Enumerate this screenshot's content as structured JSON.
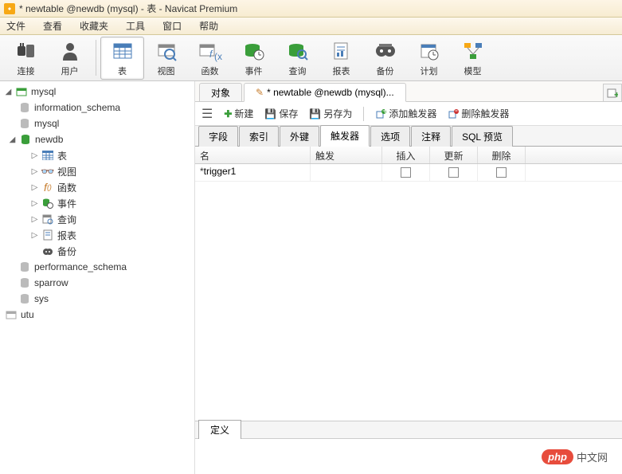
{
  "title": "* newtable @newdb (mysql) - 表 - Navicat Premium",
  "menu": [
    "文件",
    "查看",
    "收藏夹",
    "工具",
    "窗口",
    "帮助"
  ],
  "toolbar": [
    {
      "label": "连接",
      "icon": "plug"
    },
    {
      "label": "用户",
      "icon": "user"
    },
    {
      "label": "表",
      "icon": "table",
      "active": true
    },
    {
      "label": "视图",
      "icon": "view"
    },
    {
      "label": "函数",
      "icon": "fx"
    },
    {
      "label": "事件",
      "icon": "event"
    },
    {
      "label": "查询",
      "icon": "query"
    },
    {
      "label": "报表",
      "icon": "report"
    },
    {
      "label": "备份",
      "icon": "backup"
    },
    {
      "label": "计划",
      "icon": "schedule"
    },
    {
      "label": "模型",
      "icon": "model"
    }
  ],
  "tree": {
    "root": "mysql",
    "items": [
      {
        "label": "information_schema",
        "level": 2,
        "type": "db-gray"
      },
      {
        "label": "mysql",
        "level": 2,
        "type": "db-gray"
      },
      {
        "label": "newdb",
        "level": 2,
        "type": "db-green",
        "open": true
      },
      {
        "label": "表",
        "level": 3,
        "type": "table",
        "toggle": "▷"
      },
      {
        "label": "视图",
        "level": 3,
        "type": "view",
        "toggle": "▷"
      },
      {
        "label": "函数",
        "level": 3,
        "type": "fx",
        "toggle": "▷"
      },
      {
        "label": "事件",
        "level": 3,
        "type": "event",
        "toggle": "▷"
      },
      {
        "label": "查询",
        "level": 3,
        "type": "query",
        "toggle": "▷"
      },
      {
        "label": "报表",
        "level": 3,
        "type": "report",
        "toggle": "▷"
      },
      {
        "label": "备份",
        "level": 3,
        "type": "backup"
      },
      {
        "label": "performance_schema",
        "level": 2,
        "type": "db-gray"
      },
      {
        "label": "sparrow",
        "level": 2,
        "type": "db-gray"
      },
      {
        "label": "sys",
        "level": 2,
        "type": "db-gray"
      }
    ],
    "root2": "utu"
  },
  "obj_tabs": {
    "t1": "对象",
    "t2": "* newtable @newdb (mysql)..."
  },
  "actions": {
    "new": "新建",
    "save": "保存",
    "saveas": "另存为",
    "add_trigger": "添加触发器",
    "del_trigger": "删除触发器"
  },
  "sub_tabs": [
    "字段",
    "索引",
    "外键",
    "触发器",
    "选项",
    "注释",
    "SQL 预览"
  ],
  "active_sub_tab": 3,
  "grid": {
    "headers": {
      "name": "名",
      "trigger": "触发",
      "insert": "插入",
      "update": "更新",
      "delete": "删除"
    },
    "rows": [
      {
        "mark": "*",
        "name": "trigger1",
        "trigger": "",
        "insert": false,
        "update": false,
        "delete": false
      }
    ]
  },
  "def_tab": "定义",
  "watermark": {
    "badge": "php",
    "text": "中文网"
  }
}
